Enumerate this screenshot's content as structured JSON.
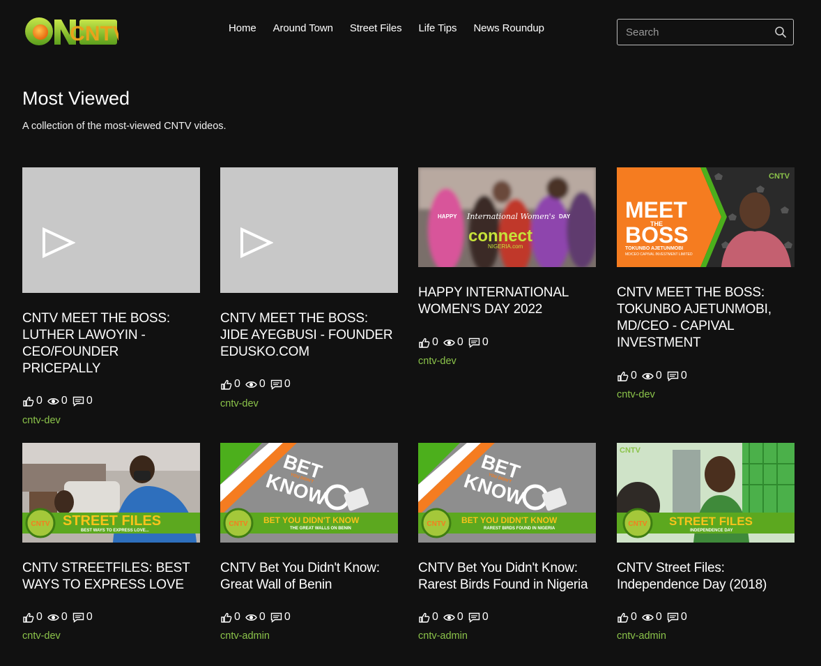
{
  "brand": {
    "logo_text": "CNTV",
    "accent": "#8bc34a",
    "orange": "#f57c20"
  },
  "nav": [
    {
      "label": "Home"
    },
    {
      "label": "Around Town"
    },
    {
      "label": "Street Files"
    },
    {
      "label": "Life Tips"
    },
    {
      "label": "News Roundup"
    }
  ],
  "search": {
    "placeholder": "Search",
    "icon": "search-icon"
  },
  "page": {
    "title": "Most Viewed",
    "description": "A collection of the most-viewed CNTV videos."
  },
  "videos": [
    {
      "title": "CNTV MEET THE BOSS: LUTHER LAWOYIN - CEO/FOUNDER PRICEPALLY",
      "likes": "0",
      "views": "0",
      "comments": "0",
      "author": "cntv-dev",
      "thumbnail": "placeholder"
    },
    {
      "title": "CNTV MEET THE BOSS: JIDE AYEGBUSI - FOUNDER EDUSKO.COM",
      "likes": "0",
      "views": "0",
      "comments": "0",
      "author": "cntv-dev",
      "thumbnail": "placeholder"
    },
    {
      "title": "HAPPY INTERNATIONAL WOMEN'S DAY 2022",
      "likes": "0",
      "views": "0",
      "comments": "0",
      "author": "cntv-dev",
      "thumbnail": "womens-day",
      "thumb_text": {
        "line1": "HAPPY",
        "line2": "International Women's",
        "line3": "DAY",
        "brand": "connect",
        "sub": "NIGERIA.com"
      }
    },
    {
      "title": "CNTV MEET THE BOSS: TOKUNBO AJETUNMOBI, MD/CEO - CAPIVAL INVESTMENT",
      "likes": "0",
      "views": "0",
      "comments": "0",
      "author": "cntv-dev",
      "thumbnail": "meet-the-boss",
      "thumb_text": {
        "line1": "MEET",
        "line2": "THE",
        "line3": "BOSS",
        "name": "TOKUNBO AJETUNMOBI",
        "role": "MD/CEO CAPIVAL INVESTMENT LIMITED",
        "logo": "CNTV"
      }
    },
    {
      "title": "CNTV STREETFILES: BEST WAYS TO EXPRESS LOVE",
      "likes": "0",
      "views": "0",
      "comments": "0",
      "author": "cntv-dev",
      "thumbnail": "street-files",
      "thumb_text": {
        "banner": "STREET FILES",
        "sub": "BEST WAYS TO EXPRESS LOVE...",
        "logo": "CNTV"
      }
    },
    {
      "title": "CNTV Bet You Didn't Know: Great Wall of Benin",
      "likes": "0",
      "views": "0",
      "comments": "0",
      "author": "cntv-admin",
      "thumbnail": "bet-you",
      "thumb_text": {
        "big1": "BET",
        "small": "YOU DIDN'T",
        "big2": "KNOW",
        "banner": "BET YOU DIDN'T KNOW",
        "sub": "THE GREAT WALLS ON BENIN",
        "logo": "CNTV"
      }
    },
    {
      "title": "CNTV Bet You Didn't Know: Rarest Birds Found in Nigeria",
      "likes": "0",
      "views": "0",
      "comments": "0",
      "author": "cntv-admin",
      "thumbnail": "bet-you",
      "thumb_text": {
        "big1": "BET",
        "small": "YOU DIDN'T",
        "big2": "KNOW",
        "banner": "BET YOU DIDN'T KNOW",
        "sub": "RAREST BIRDS FOUND IN NIGERIA",
        "logo": "CNTV"
      }
    },
    {
      "title": "CNTV Street Files: Independence Day (2018)",
      "likes": "0",
      "views": "0",
      "comments": "0",
      "author": "cntv-admin",
      "thumbnail": "street-files-2",
      "thumb_text": {
        "banner": "STREET FILES",
        "sub": "INDEPENDENCE DAY",
        "logo": "CNTV"
      }
    }
  ]
}
